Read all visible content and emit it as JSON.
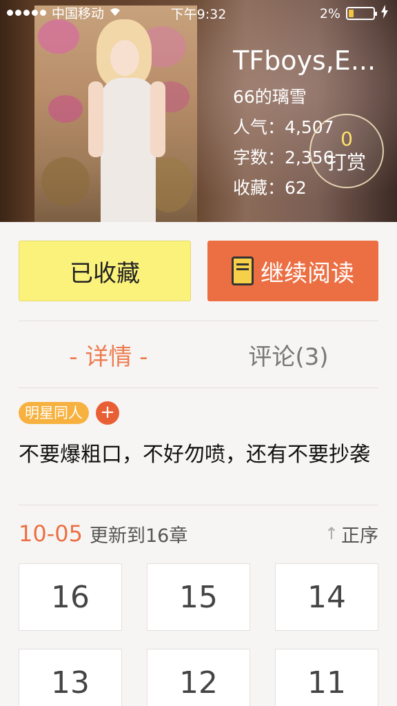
{
  "status_bar": {
    "carrier": "中国移动",
    "time": "下午9:32",
    "battery": "2%",
    "battery_level": 0.2
  },
  "book": {
    "title": "TFboys,E...",
    "author": "66的璃雪",
    "popularity_label": "人气：",
    "popularity": "4,507",
    "words_label": "字数：",
    "words": "2,356",
    "favorites_label": "收藏：",
    "favorites": "62"
  },
  "tip": {
    "count": "0",
    "label": "打赏"
  },
  "actions": {
    "favorite_label": "已收藏",
    "read_label": "继续阅读"
  },
  "tabs": [
    {
      "label": "- 详情 -"
    },
    {
      "label": "评论(3)"
    }
  ],
  "tags": [
    "明星同人"
  ],
  "tag_add": "+",
  "description": "不要爆粗口，不好勿喷，还有不要抄袭",
  "update": {
    "date": "10-05",
    "text": "更新到16章",
    "sort_label": "正序"
  },
  "chapters": [
    "16",
    "15",
    "14",
    "13",
    "12",
    "11"
  ],
  "colors": {
    "accent": "#ec6f43",
    "favorite": "#fbf27c",
    "tag": "#f7b13e"
  }
}
